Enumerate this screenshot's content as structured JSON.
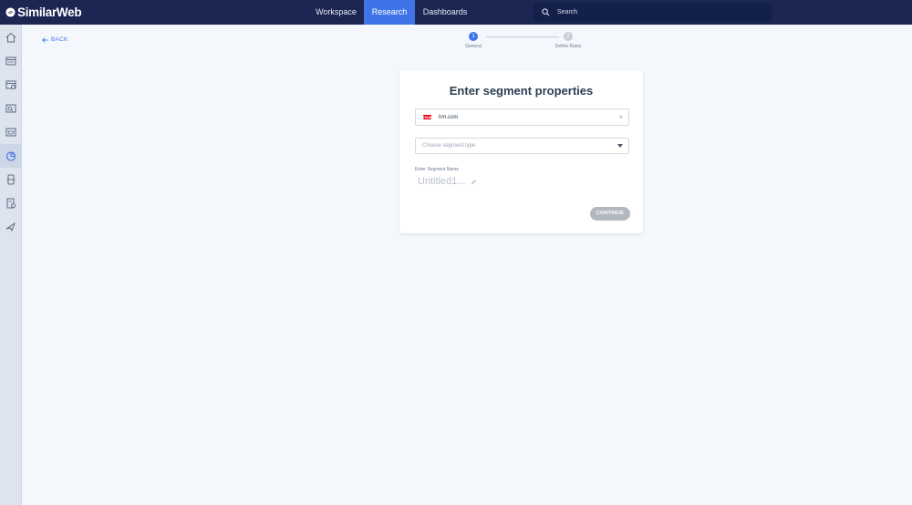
{
  "app": {
    "logo_text": "SimilarWeb"
  },
  "nav": {
    "items": [
      {
        "label": "Workspace",
        "active": false
      },
      {
        "label": "Research",
        "active": true
      },
      {
        "label": "Dashboards",
        "active": false
      }
    ]
  },
  "search": {
    "label": "Search"
  },
  "sidebar": {
    "items": [
      {
        "icon": "home-icon",
        "active": false
      },
      {
        "icon": "website-icon",
        "active": false
      },
      {
        "icon": "website-analysis-icon",
        "active": false
      },
      {
        "icon": "search-analysis-icon",
        "active": false
      },
      {
        "icon": "shopping-icon",
        "active": false
      },
      {
        "icon": "segments-icon",
        "active": true
      },
      {
        "icon": "app-icon",
        "active": false
      },
      {
        "icon": "reports-icon",
        "active": false
      },
      {
        "icon": "marketing-icon",
        "active": false
      }
    ]
  },
  "back": {
    "label": "BACK"
  },
  "stepper": {
    "steps": [
      {
        "number": "1",
        "label": "General",
        "active": true
      },
      {
        "number": "2",
        "label": "Define Rules",
        "active": false
      }
    ]
  },
  "card": {
    "title": "Enter segment properties",
    "site": {
      "value": "hm.com",
      "favicon_text": "H&M"
    },
    "segment_type": {
      "placeholder": "Choose segment type"
    },
    "segment_name": {
      "label": "Enter Segment Name",
      "value": "Untitled1..."
    },
    "continue_label": "CONTINUE"
  },
  "colors": {
    "topbar": "#1b2653",
    "accent": "#3e74e8",
    "page_bg": "#f4f7fc",
    "disabled_button": "#b3b8c0"
  }
}
